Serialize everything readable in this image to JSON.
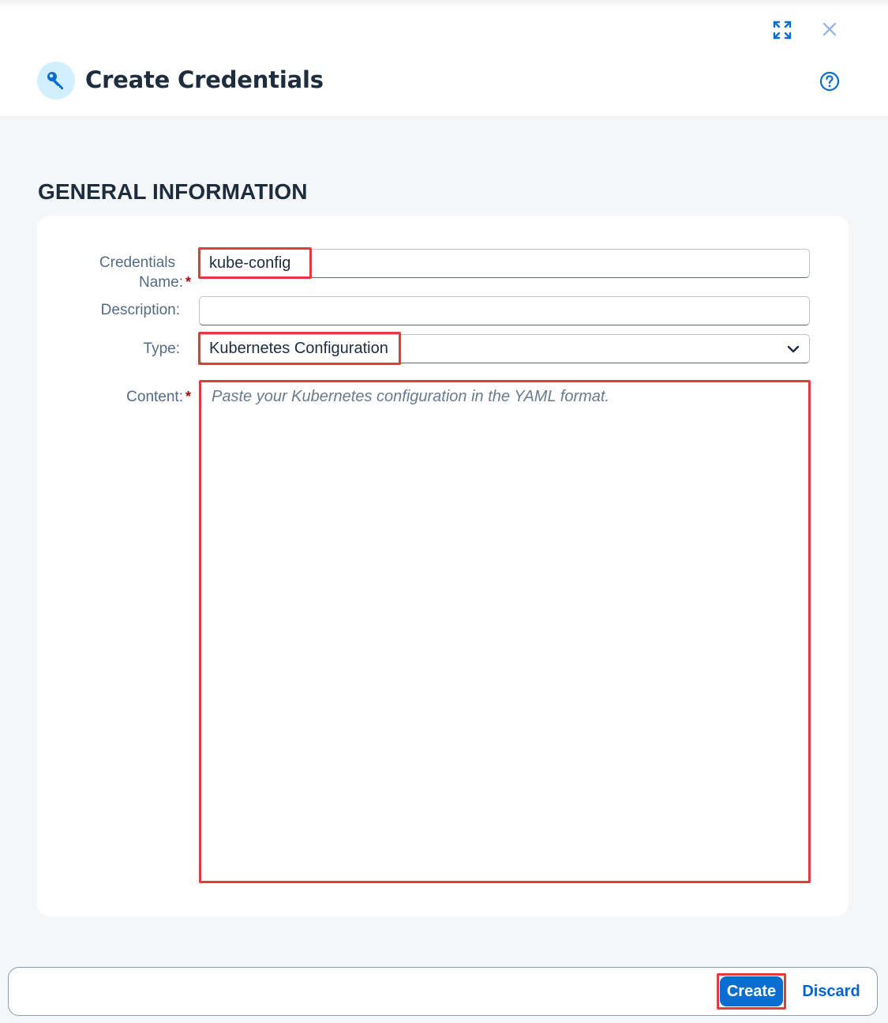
{
  "dialog": {
    "title": "Create Credentials",
    "icon": "key-icon",
    "actions": [
      "fullscreen-icon",
      "close-icon",
      "help-icon"
    ]
  },
  "section": {
    "title": "GENERAL INFORMATION"
  },
  "form": {
    "credentials_name_label_line1": "Credentials",
    "credentials_name_label_line2": "Name:",
    "credentials_name_value": "kube-config",
    "description_label": "Description:",
    "description_value": "",
    "type_label": "Type:",
    "type_value": "Kubernetes Configuration",
    "content_label": "Content:",
    "content_placeholder": "Paste your Kubernetes configuration in the YAML format.",
    "required_marker": "*"
  },
  "footer": {
    "create_label": "Create",
    "discard_label": "Discard"
  },
  "colors": {
    "accent": "#0a6ed1",
    "highlight": "#e03c3c",
    "required": "#aa0808"
  }
}
